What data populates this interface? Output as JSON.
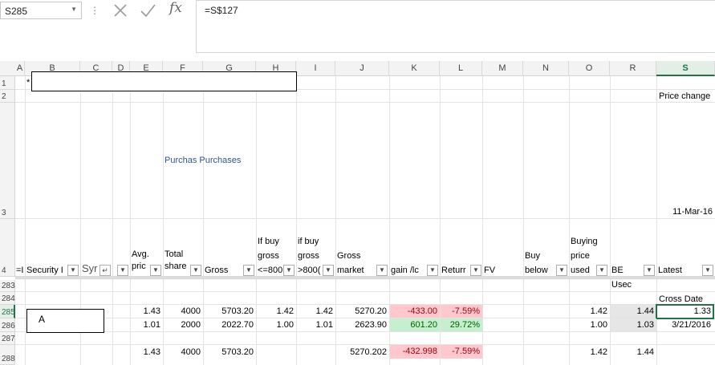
{
  "formula_bar": {
    "name_box": "S285",
    "formula": "=S$127",
    "icons": {
      "cancel": "x-icon",
      "enter": "checkmark-icon",
      "function": "fx-icon"
    },
    "fx_label": "fx",
    "dots": "⋮"
  },
  "columns": [
    "A",
    "B",
    "C",
    "D",
    "E",
    "F",
    "G",
    "H",
    "I",
    "J",
    "K",
    "L",
    "M",
    "N",
    "O",
    "R",
    "S"
  ],
  "selected_column": "S",
  "rows": [
    "1",
    "2",
    "3",
    "4",
    "283",
    "284",
    "285",
    "286",
    "287",
    "288"
  ],
  "selected_row": "285",
  "row1": {
    "a1": "*"
  },
  "row2": {
    "s2": "Price change"
  },
  "row3": {
    "purchases_label": "Purchas Purchases",
    "date": "11-Mar-16"
  },
  "header_row": {
    "a4": "=I",
    "security": "Security I",
    "sym": "Syr",
    "avg_price": [
      "Avg.",
      "pric"
    ],
    "total_shares": [
      "Total",
      "share"
    ],
    "gross": "Gross",
    "if_buy_lte": [
      "If buy",
      "gross",
      "<=800"
    ],
    "if_buy_gt": [
      "if buy",
      "gross",
      ">800("
    ],
    "gross_market": [
      "Gross",
      "market"
    ],
    "gain_loss": "gain  /lc",
    "return": "Returr",
    "fv": "FV",
    "buy_below": [
      "Buy",
      "below"
    ],
    "buying_price_used": [
      "Buying",
      "price",
      "used"
    ],
    "be_used": "BE Usec",
    "latest": "Latest"
  },
  "row284": {
    "s": "Cross Date"
  },
  "row285": {
    "security": "A",
    "e": "1.43",
    "f": "4000",
    "g": "5703.20",
    "h": "1.42",
    "i": "1.42",
    "j": "5270.20",
    "k": "-433.00",
    "l": "-7.59%",
    "o": "1.42",
    "r": "1.44",
    "s": "1.33"
  },
  "row286": {
    "e": "1.01",
    "f": "2000",
    "g": "2022.70",
    "h": "1.00",
    "i": "1.01",
    "j": "2623.90",
    "k": "601.20",
    "l": "29.72%",
    "o": "1.00",
    "r": "1.03",
    "s": "3/21/2016"
  },
  "row288": {
    "e": "1.43",
    "f": "4000",
    "g": "5703.20",
    "j": "5270.202",
    "k": "-432.998",
    "l": "-7.59%",
    "o": "1.42",
    "r": "1.44"
  },
  "colors": {
    "excel_green": "#217346",
    "bad_fill": "#ffc7ce",
    "bad_text": "#9c0006",
    "good_fill": "#c6efce",
    "good_text": "#006100",
    "link_blue": "#2b5797"
  }
}
